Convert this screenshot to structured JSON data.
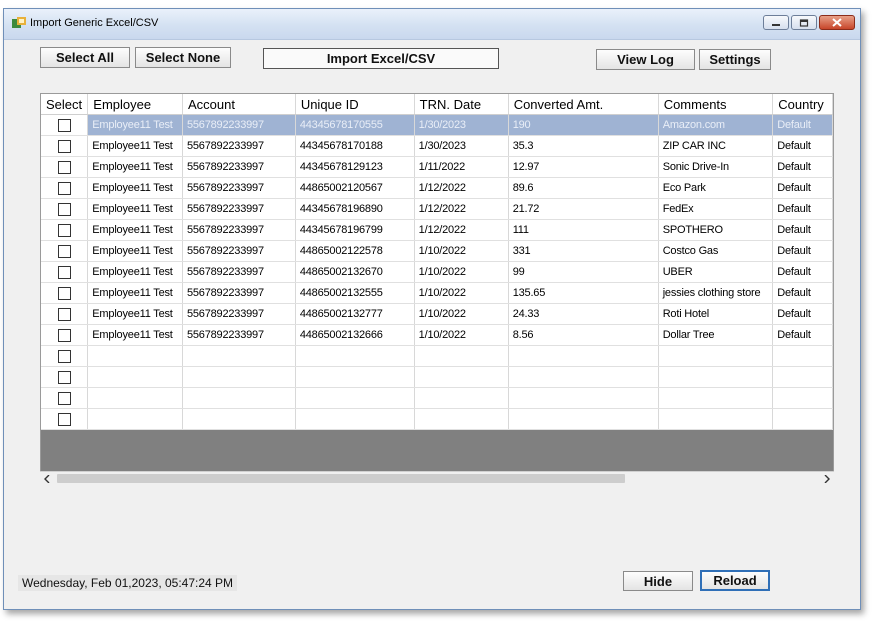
{
  "window": {
    "title": "Import Generic Excel/CSV"
  },
  "toolbar": {
    "select_all": "Select All",
    "select_none": "Select None",
    "import": "Import Excel/CSV",
    "view_log": "View Log",
    "settings": "Settings"
  },
  "grid": {
    "columns": [
      "Select",
      "Employee",
      "Account",
      "Unique ID",
      "TRN. Date",
      "Converted Amt.",
      "Comments",
      "Country"
    ],
    "rows": [
      {
        "employee": "Employee11 Test",
        "account": "5567892233997",
        "unique_id": "44345678170555",
        "date": "1/30/2023",
        "amount": "190",
        "comments": "Amazon.com",
        "country": "Default",
        "selected": true
      },
      {
        "employee": "Employee11 Test",
        "account": "5567892233997",
        "unique_id": "44345678170188",
        "date": "1/30/2023",
        "amount": "35.3",
        "comments": "ZIP CAR INC",
        "country": "Default",
        "selected": false
      },
      {
        "employee": "Employee11 Test",
        "account": "5567892233997",
        "unique_id": "44345678129123",
        "date": "1/11/2022",
        "amount": "12.97",
        "comments": "Sonic Drive-In",
        "country": "Default",
        "selected": false
      },
      {
        "employee": "Employee11 Test",
        "account": "5567892233997",
        "unique_id": "44865002120567",
        "date": "1/12/2022",
        "amount": "89.6",
        "comments": "Eco Park",
        "country": "Default",
        "selected": false
      },
      {
        "employee": "Employee11 Test",
        "account": "5567892233997",
        "unique_id": "44345678196890",
        "date": "1/12/2022",
        "amount": "21.72",
        "comments": "FedEx",
        "country": "Default",
        "selected": false
      },
      {
        "employee": "Employee11 Test",
        "account": "5567892233997",
        "unique_id": "44345678196799",
        "date": "1/12/2022",
        "amount": "111",
        "comments": "SPOTHERO",
        "country": "Default",
        "selected": false
      },
      {
        "employee": "Employee11 Test",
        "account": "5567892233997",
        "unique_id": "44865002122578",
        "date": "1/10/2022",
        "amount": "331",
        "comments": "Costco Gas",
        "country": "Default",
        "selected": false
      },
      {
        "employee": "Employee11 Test",
        "account": "5567892233997",
        "unique_id": "44865002132670",
        "date": "1/10/2022",
        "amount": "99",
        "comments": "UBER",
        "country": "Default",
        "selected": false
      },
      {
        "employee": "Employee11 Test",
        "account": "5567892233997",
        "unique_id": "44865002132555",
        "date": "1/10/2022",
        "amount": "135.65",
        "comments": "jessies clothing store",
        "country": "Default",
        "selected": false
      },
      {
        "employee": "Employee11 Test",
        "account": "5567892233997",
        "unique_id": "44865002132777",
        "date": "1/10/2022",
        "amount": "24.33",
        "comments": "Roti Hotel",
        "country": "Default",
        "selected": false
      },
      {
        "employee": "Employee11 Test",
        "account": "5567892233997",
        "unique_id": "44865002132666",
        "date": "1/10/2022",
        "amount": "8.56",
        "comments": "Dollar Tree",
        "country": "Default",
        "selected": false
      },
      {
        "employee": "",
        "account": "",
        "unique_id": "",
        "date": "",
        "amount": "",
        "comments": "",
        "country": "",
        "selected": false
      },
      {
        "employee": "",
        "account": "",
        "unique_id": "",
        "date": "",
        "amount": "",
        "comments": "",
        "country": "",
        "selected": false
      },
      {
        "employee": "",
        "account": "",
        "unique_id": "",
        "date": "",
        "amount": "",
        "comments": "",
        "country": "",
        "selected": false
      },
      {
        "employee": "",
        "account": "",
        "unique_id": "",
        "date": "",
        "amount": "",
        "comments": "",
        "country": "",
        "selected": false
      }
    ]
  },
  "footer": {
    "status": "Wednesday, Feb 01,2023, 05:47:24 PM",
    "hide": "Hide",
    "reload": "Reload"
  },
  "colors": {
    "selected_row": "#9fb3d3",
    "grid_empty_area": "#808080",
    "focus_border": "#2f6fb7"
  },
  "icons": {
    "app": "excel-import-icon",
    "minimize": "minimize-icon",
    "maximize": "maximize-icon",
    "close": "close-icon",
    "scroll_left": "arrow-left-icon",
    "scroll_right": "arrow-right-icon"
  }
}
